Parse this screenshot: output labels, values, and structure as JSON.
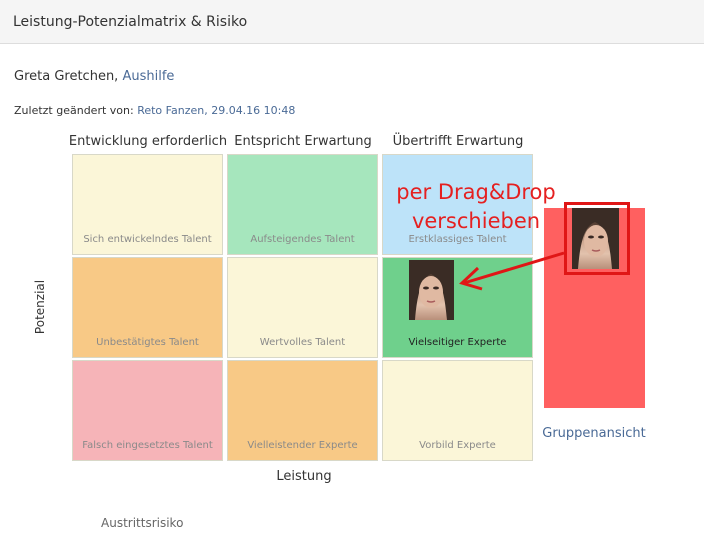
{
  "header": {
    "title": "Leistung-Potenzialmatrix & Risiko"
  },
  "employee": {
    "name": "Greta Gretchen,",
    "role": "Aushilfe"
  },
  "last_changed": {
    "label": "Zuletzt geändert von:",
    "value": "Reto Fanzen, 29.04.16 10:48"
  },
  "matrix": {
    "columns": [
      "Entwicklung erforderlich",
      "Entspricht Erwartung",
      "Übertrifft Erwartung"
    ],
    "cells": [
      {
        "label": "Sich entwickelndes Talent",
        "color": "#fbf6d8"
      },
      {
        "label": "Aufsteigendes Talent",
        "color": "#a6e6bd"
      },
      {
        "label": "Erstklassiges Talent",
        "color": "#bde3f9"
      },
      {
        "label": "Unbestätigtes Talent",
        "color": "#f8c986"
      },
      {
        "label": "Wertvolles Talent",
        "color": "#fbf6d8"
      },
      {
        "label": "Vielseitiger Experte",
        "color": "#6fd08c"
      },
      {
        "label": "Falsch eingesetztes Talent",
        "color": "#f6b4b8"
      },
      {
        "label": "Vielleistender Experte",
        "color": "#f8c986"
      },
      {
        "label": "Vorbild Experte",
        "color": "#fbf6d8"
      }
    ],
    "y_axis_label": "Potenzial",
    "x_axis_label": "Leistung"
  },
  "group_view": {
    "label": "Gruppenansicht",
    "color": "#ff6060"
  },
  "exit_risk": {
    "label": "Austrittsrisiko"
  },
  "annotation": {
    "line1": "per Drag&Drop",
    "line2": "verschieben",
    "color": "#e52020"
  }
}
